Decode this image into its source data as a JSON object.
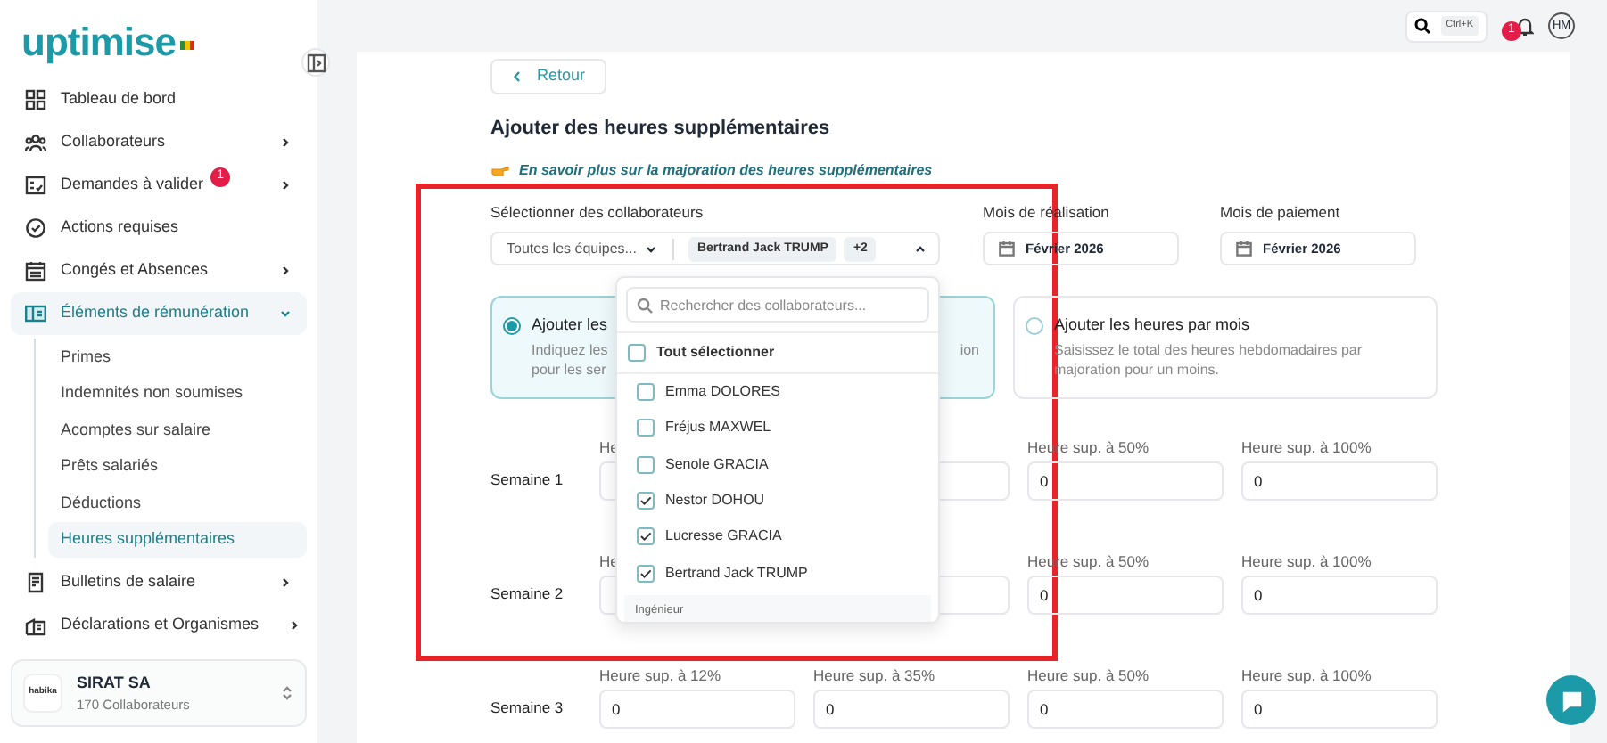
{
  "logo": {
    "text": "uptimise"
  },
  "sidebar": {
    "items": [
      {
        "label": "Tableau de bord",
        "chevron": false
      },
      {
        "label": "Collaborateurs",
        "chevron": true
      },
      {
        "label": "Demandes à valider",
        "chevron": true,
        "badge": "1"
      },
      {
        "label": "Actions requises",
        "chevron": false
      },
      {
        "label": "Congés et Absences",
        "chevron": true
      },
      {
        "label": "Éléments de rémunération",
        "chevron": true,
        "expanded": true,
        "children": [
          {
            "label": "Primes",
            "selected": false
          },
          {
            "label": "Indemnités non soumises",
            "selected": false
          },
          {
            "label": "Acomptes sur salaire",
            "selected": false
          },
          {
            "label": "Prêts salariés",
            "selected": false
          },
          {
            "label": "Déductions",
            "selected": false
          },
          {
            "label": "Heures supplémentaires",
            "selected": true
          }
        ]
      },
      {
        "label": "Bulletins de salaire",
        "chevron": true
      },
      {
        "label": "Déclarations et Organismes",
        "chevron": true
      }
    ],
    "company": {
      "logo_text": "habika",
      "name": "SIRAT SA",
      "subtitle": "170 Collaborateurs"
    }
  },
  "topbar": {
    "shortcut": "Ctrl+K",
    "notifications": "1",
    "avatar": "HM"
  },
  "back_button": "Retour",
  "title": "Ajouter des heures supplémentaires",
  "info_link": "En savoir plus sur la majoration des heures supplémentaires",
  "collaborators": {
    "label": "Sélectionner des collaborateurs",
    "team_select": "Toutes les équipes...",
    "selected_tag": "Bertrand Jack TRUMP",
    "more_tag": "+2",
    "expanded": true
  },
  "months": [
    {
      "label": "Mois de réalisation",
      "value": "Février 2026"
    },
    {
      "label": "Mois de paiement",
      "value": "Février 2026"
    }
  ],
  "modes": [
    {
      "title": "Ajouter les",
      "description": [
        "Indiquez les",
        "pour les ser"
      ],
      "description_tail": "ion",
      "selected": true
    },
    {
      "title": "Ajouter les heures par mois",
      "description": [
        "Saisissez le total des heures hebdomadaires par",
        "majoration pour un moins."
      ],
      "selected": false
    }
  ],
  "weeks": [
    {
      "label": "Semaine 1",
      "fields": [
        {
          "kind": "partial",
          "label": "He"
        },
        {
          "kind": "blank"
        },
        {
          "kind": "number",
          "label": "Heure sup. à 50%",
          "value": "0"
        },
        {
          "kind": "number",
          "label": "Heure sup. à 100%",
          "value": "0"
        }
      ]
    },
    {
      "label": "Semaine 2",
      "fields": [
        {
          "kind": "partial",
          "label": "He"
        },
        {
          "kind": "blank"
        },
        {
          "kind": "number",
          "label": "Heure sup. à 50%",
          "value": "0"
        },
        {
          "kind": "number",
          "label": "Heure sup. à 100%",
          "value": "0"
        }
      ]
    },
    {
      "label": "Semaine 3",
      "fields": [
        {
          "kind": "number",
          "label": "Heure sup. à 12%",
          "value": "0"
        },
        {
          "kind": "number",
          "label": "Heure sup. à 35%",
          "value": "0"
        },
        {
          "kind": "number",
          "label": "Heure sup. à 50%",
          "value": "0"
        },
        {
          "kind": "number",
          "label": "Heure sup. à 100%",
          "value": "0"
        }
      ]
    }
  ],
  "dropdown": {
    "search_placeholder": "Rechercher des collaborateurs...",
    "select_all": {
      "label": "Tout sélectionner",
      "checked": false
    },
    "options": [
      {
        "label": "Emma DOLORES",
        "checked": false
      },
      {
        "label": "Fréjus MAXWEL",
        "checked": false
      },
      {
        "label": "Senole GRACIA",
        "checked": false
      },
      {
        "label": "Nestor DOHOU",
        "checked": true
      },
      {
        "label": "Lucresse GRACIA",
        "checked": true
      },
      {
        "label": "Bertrand Jack TRUMP",
        "checked": true
      }
    ],
    "group_header": "Ingénieur"
  },
  "highlight_frame": true
}
